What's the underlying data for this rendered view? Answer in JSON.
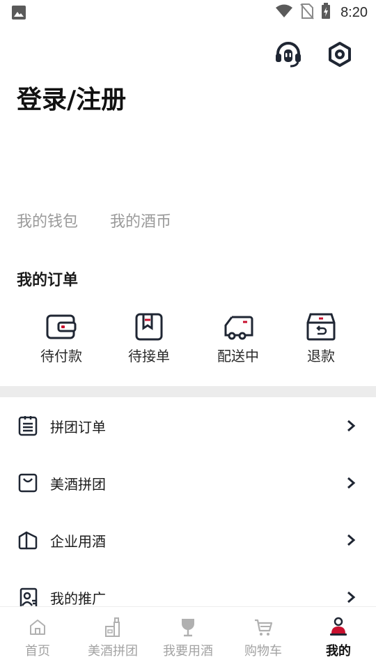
{
  "status_bar": {
    "time": "8:20"
  },
  "header": {
    "login_title": "登录/注册"
  },
  "wallet": {
    "wallet_label": "我的钱包",
    "coin_label": "我的酒币"
  },
  "orders": {
    "title": "我的订单",
    "items": [
      {
        "label": "待付款",
        "icon": "wallet-icon"
      },
      {
        "label": "待接单",
        "icon": "bookmark-book-icon"
      },
      {
        "label": "配送中",
        "icon": "truck-icon"
      },
      {
        "label": "退款",
        "icon": "refund-box-icon"
      }
    ]
  },
  "menu": {
    "items": [
      {
        "label": "拼团订单",
        "icon": "list-icon"
      },
      {
        "label": "美酒拼团",
        "icon": "bag-icon"
      },
      {
        "label": "企业用酒",
        "icon": "building-icon"
      },
      {
        "label": "我的推广",
        "icon": "promo-icon"
      }
    ]
  },
  "tabbar": {
    "items": [
      {
        "label": "首页",
        "icon": "home-icon",
        "active": false
      },
      {
        "label": "美酒拼团",
        "icon": "bottle-icon",
        "active": false
      },
      {
        "label": "我要用酒",
        "icon": "wine-glass-icon",
        "active": false
      },
      {
        "label": "购物车",
        "icon": "cart-icon",
        "active": false
      },
      {
        "label": "我的",
        "icon": "profile-icon",
        "active": true
      }
    ]
  },
  "colors": {
    "accent": "#c8102e",
    "text": "#1c1c1c",
    "muted": "#9a9a9a",
    "divider": "#ececec"
  }
}
